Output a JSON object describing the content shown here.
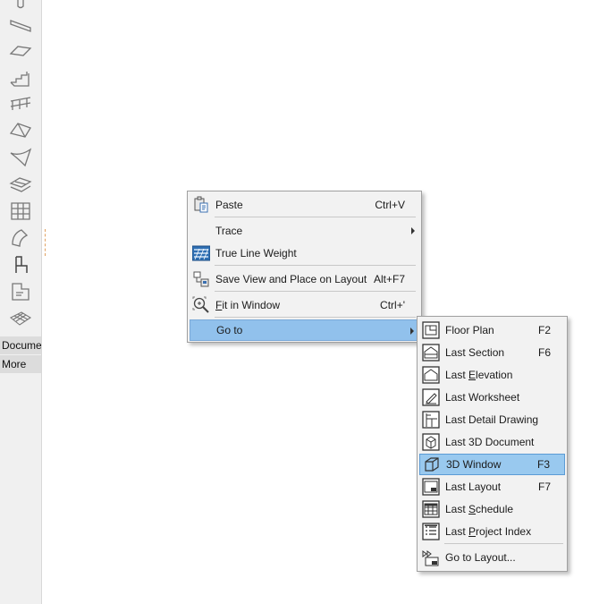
{
  "toolbox": {
    "tools": [
      {
        "name": "column-tool-icon"
      },
      {
        "name": "beam-tool-icon"
      },
      {
        "name": "slab-tool-icon"
      },
      {
        "name": "stair-tool-icon"
      },
      {
        "name": "railing-tool-icon"
      },
      {
        "name": "roof-tool-icon"
      },
      {
        "name": "shell-tool-icon"
      },
      {
        "name": "skylight-tool-icon"
      },
      {
        "name": "curtain-wall-tool-icon"
      },
      {
        "name": "morph-tool-icon"
      },
      {
        "name": "object-tool-icon"
      },
      {
        "name": "zone-tool-icon"
      },
      {
        "name": "mesh-tool-icon"
      }
    ],
    "tab_document": "Docume",
    "tab_more": "More"
  },
  "context_menu": {
    "paste": {
      "label": "Paste",
      "shortcut": "Ctrl+V"
    },
    "trace": {
      "label": "Trace"
    },
    "true_line_weight": {
      "label": "True Line Weight"
    },
    "save_view": {
      "label": "Save View and Place on Layout",
      "shortcut": "Alt+F7"
    },
    "fit_in_window": {
      "label_u": "F",
      "label_rest": "it in Window",
      "shortcut": "Ctrl+'"
    },
    "go_to": {
      "label": "Go to"
    }
  },
  "goto_submenu": {
    "floor_plan": {
      "label": "Floor Plan",
      "shortcut": "F2"
    },
    "last_section": {
      "label": "Last Section",
      "shortcut": "F6"
    },
    "last_elevation": {
      "pre": "Last ",
      "u": "E",
      "post": "levation"
    },
    "last_worksheet": {
      "label": "Last Worksheet"
    },
    "last_detail": {
      "label": "Last Detail Drawing"
    },
    "last_3d_document": {
      "label": "Last 3D Document"
    },
    "window_3d": {
      "label": "3D Window",
      "shortcut": "F3"
    },
    "last_layout": {
      "label": "Last Layout",
      "shortcut": "F7"
    },
    "last_schedule": {
      "pre": "Last ",
      "u": "S",
      "post": "chedule"
    },
    "last_project_index": {
      "pre": "Last ",
      "u": "P",
      "post": "roject Index"
    },
    "go_to_layout": {
      "label": "Go to Layout..."
    }
  },
  "colors": {
    "highlight": "#99c9ef",
    "highlight_border": "#5b9bd5",
    "menu_bg": "#f2f2f2"
  }
}
